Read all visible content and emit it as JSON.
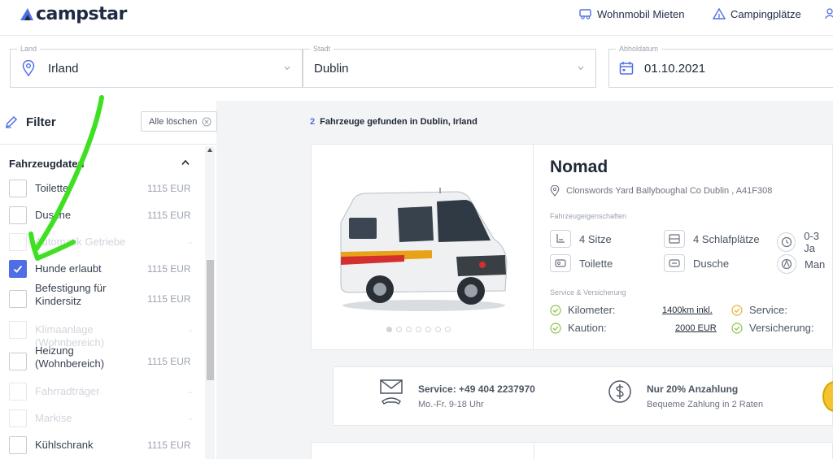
{
  "header": {
    "brand": "campstar",
    "nav": [
      {
        "label": "Wohnmobil Mieten",
        "icon": "camper-icon"
      },
      {
        "label": "Campingplätze",
        "icon": "tent-icon"
      }
    ]
  },
  "search": {
    "country": {
      "label": "Land",
      "value": "Irland"
    },
    "city": {
      "label": "Stadt",
      "value": "Dublin"
    },
    "pickup": {
      "label": "Abholdatum",
      "value": "01.10.2021"
    }
  },
  "filter": {
    "title": "Filter",
    "clear_label": "Alle löschen",
    "section_title": "Fahrzeugdaten",
    "items": [
      {
        "label": "Toilette",
        "price": "1115 EUR",
        "checked": false,
        "disabled": false
      },
      {
        "label": "Dusche",
        "price": "1115 EUR",
        "checked": false,
        "disabled": false
      },
      {
        "label": "Automatik Getriebe",
        "price": "-",
        "checked": false,
        "disabled": true
      },
      {
        "label": "Hunde erlaubt",
        "price": "1115 EUR",
        "checked": true,
        "disabled": false
      },
      {
        "label": "Befestigung für Kindersitz",
        "price": "1115 EUR",
        "checked": false,
        "disabled": false
      },
      {
        "label": "Klimaanlage (Wohnbereich)",
        "price": "-",
        "checked": false,
        "disabled": true
      },
      {
        "label": "Heizung (Wohnbereich)",
        "price": "1115 EUR",
        "checked": false,
        "disabled": false
      },
      {
        "label": "Fahrradträger",
        "price": "-",
        "checked": false,
        "disabled": true
      },
      {
        "label": "Markise",
        "price": "-",
        "checked": false,
        "disabled": true
      },
      {
        "label": "Kühlschrank",
        "price": "1115 EUR",
        "checked": false,
        "disabled": false
      }
    ]
  },
  "results": {
    "count": "2",
    "count_text": "Fahrzeuge gefunden in Dublin, Irland"
  },
  "vehicle": {
    "name": "Nomad",
    "address": "Clonswords Yard Ballyboughal Co Dublin , A41F308",
    "features_heading": "Fahrzeugeigenschaften",
    "features": [
      {
        "label": "4 Sitze",
        "icon": "seat-icon"
      },
      {
        "label": "4 Schlafplätze",
        "icon": "bed-icon"
      },
      {
        "label": "0-3 Ja",
        "icon": "clock-icon"
      },
      {
        "label": "Toilette",
        "icon": "toilet-icon"
      },
      {
        "label": "Dusche",
        "icon": "shower-icon"
      },
      {
        "label": "Man",
        "icon": "steering-icon"
      }
    ],
    "service_heading": "Service & Versicherung",
    "km_label": "Kilometer:",
    "km_value": "1400km inkl.",
    "deposit_label": "Kaution:",
    "deposit_value": "2000 EUR",
    "service_label": "Service:",
    "insurance_label": "Versicherung:",
    "image_dots": 7,
    "active_dot": 0
  },
  "info": {
    "service_title": "Service: +49 404 2237970",
    "service_hours": "Mo.-Fr. 9-18 Uhr",
    "payment_title": "Nur 20% Anzahlung",
    "payment_sub": "Bequeme Zahlung in 2 Raten"
  },
  "colors": {
    "accent": "#4f6ee6",
    "check_green": "#8bc34a",
    "check_amber": "#e8b23a",
    "annotation_green": "#3ee021"
  }
}
